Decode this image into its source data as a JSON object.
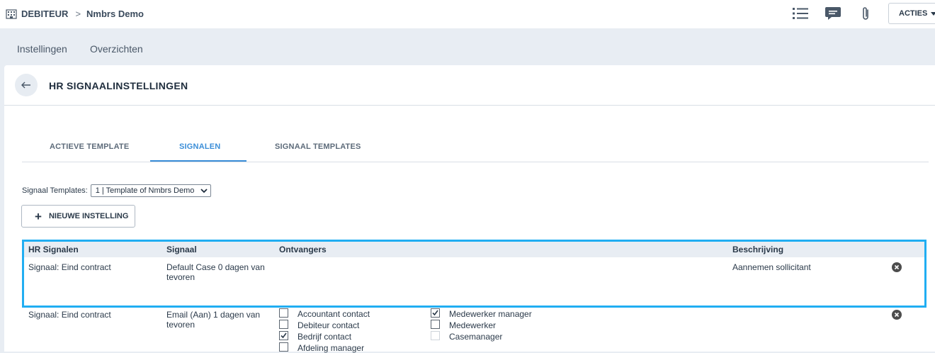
{
  "breadcrumb": {
    "section": "DEBITEUR",
    "separator": ">",
    "name": "Nmbrs Demo"
  },
  "toolbar": {
    "acties_label": "ACTIES",
    "icons": [
      "list-icon",
      "chat-icon",
      "paperclip-icon"
    ]
  },
  "subnav": {
    "items": [
      "Instellingen",
      "Overzichten"
    ]
  },
  "page": {
    "title": "HR SIGNAALINSTELLINGEN"
  },
  "tabs": [
    {
      "label": "ACTIEVE TEMPLATE"
    },
    {
      "label": "SIGNALEN",
      "active": true
    },
    {
      "label": "SIGNAAL TEMPLATES"
    }
  ],
  "templates": {
    "label": "Signaal Templates:",
    "selected": "1 | Template of Nmbrs Demo"
  },
  "new_button": {
    "label": "NIEUWE INSTELLING"
  },
  "table": {
    "headers": [
      "HR Signalen",
      "Signaal",
      "Ontvangers",
      "Beschrijving"
    ],
    "rows": [
      {
        "hr_signal": "Signaal: Eind contract",
        "signaal_line1": "Default Case 0 dagen van",
        "signaal_line2": "tevoren",
        "beschrijving": "Aannemen sollicitant"
      },
      {
        "hr_signal": "Signaal: Eind contract",
        "signaal_line1": "Email (Aan) 1 dagen van",
        "signaal_line2": "tevoren",
        "beschrijving": "",
        "recipients_left": [
          {
            "label": "Accountant contact",
            "checked": false
          },
          {
            "label": "Debiteur contact",
            "checked": false
          },
          {
            "label": "Bedrijf contact",
            "checked": true
          },
          {
            "label": "Afdeling manager",
            "checked": false
          }
        ],
        "recipients_right": [
          {
            "label": "Medewerker manager",
            "checked": true
          },
          {
            "label": "Medewerker",
            "checked": false
          },
          {
            "label": "Casemanager",
            "checked": false,
            "disabled": true
          }
        ]
      }
    ]
  },
  "colors": {
    "accent": "#3b8ed8",
    "highlight": "#21aef2",
    "header_bg": "#e8edf3"
  }
}
